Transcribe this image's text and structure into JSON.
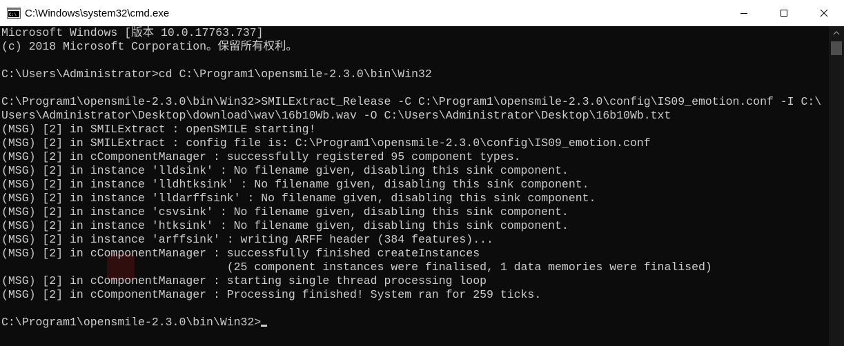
{
  "window": {
    "title": "C:\\Windows\\system32\\cmd.exe",
    "icon": "cmd-icon"
  },
  "controls": {
    "minimize": "minimize-icon",
    "maximize": "maximize-icon",
    "close": "close-icon"
  },
  "console": {
    "lines": [
      "Microsoft Windows [版本 10.0.17763.737]",
      "(c) 2018 Microsoft Corporation。保留所有权利。",
      "",
      "C:\\Users\\Administrator>cd C:\\Program1\\opensmile-2.3.0\\bin\\Win32",
      "",
      "C:\\Program1\\opensmile-2.3.0\\bin\\Win32>SMILExtract_Release -C C:\\Program1\\opensmile-2.3.0\\config\\IS09_emotion.conf -I C:\\",
      "Users\\Administrator\\Desktop\\download\\wav\\16b10Wb.wav -O C:\\Users\\Administrator\\Desktop\\16b10Wb.txt",
      "(MSG) [2] in SMILExtract : openSMILE starting!",
      "(MSG) [2] in SMILExtract : config file is: C:\\Program1\\opensmile-2.3.0\\config\\IS09_emotion.conf",
      "(MSG) [2] in cComponentManager : successfully registered 95 component types.",
      "(MSG) [2] in instance 'lldsink' : No filename given, disabling this sink component.",
      "(MSG) [2] in instance 'lldhtksink' : No filename given, disabling this sink component.",
      "(MSG) [2] in instance 'lldarffsink' : No filename given, disabling this sink component.",
      "(MSG) [2] in instance 'csvsink' : No filename given, disabling this sink component.",
      "(MSG) [2] in instance 'htksink' : No filename given, disabling this sink component.",
      "(MSG) [2] in instance 'arffsink' : writing ARFF header (384 features)...",
      "(MSG) [2] in cComponentManager : successfully finished createInstances",
      "                                 (25 component instances were finalised, 1 data memories were finalised)",
      "(MSG) [2] in cComponentManager : starting single thread processing loop",
      "(MSG) [2] in cComponentManager : Processing finished! System ran for 259 ticks.",
      "",
      "C:\\Program1\\opensmile-2.3.0\\bin\\Win32>"
    ]
  },
  "colors": {
    "background": "#0c0c0c",
    "text": "#cccccc",
    "titlebar": "#ffffff"
  }
}
